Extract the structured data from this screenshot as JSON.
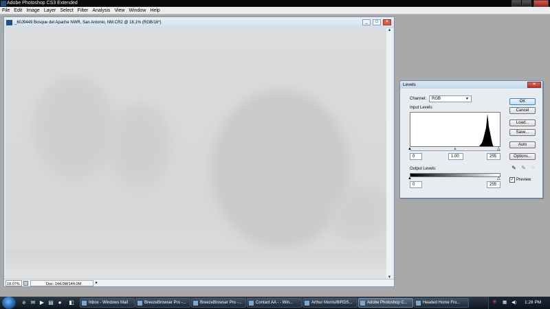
{
  "app": {
    "title": "Adobe Photoshop CS3 Extended"
  },
  "menu": [
    "File",
    "Edit",
    "Image",
    "Layer",
    "Select",
    "Filter",
    "Analysis",
    "View",
    "Window",
    "Help"
  ],
  "document": {
    "title": "_60J9449  Bosque del Apache NWR, San Antonio, NM.CR2 @ 18.1% (RGB/16*)",
    "zoom": "18.07%",
    "doc_info": "Doc: 144.0M/144.0M",
    "next_arrow": "▸",
    "btn_min": "_",
    "btn_max": "□",
    "btn_close": "✕",
    "scroll_up": "▲",
    "scroll_down": "▼"
  },
  "levels": {
    "title": "Levels",
    "close": "✕",
    "channel_label": "Channel:",
    "channel_value": "RGB",
    "caret": "▼",
    "input_label": "Input Levels:",
    "input_black": "0",
    "input_gamma": "1.00",
    "input_white": "255",
    "output_label": "Output Levels:",
    "output_black": "0",
    "output_white": "255",
    "buttons": {
      "ok": "OK",
      "cancel": "Cancel",
      "load": "Load...",
      "save": "Save...",
      "auto": "Auto",
      "options": "Options..."
    },
    "eyedropper_icon": "✎",
    "preview_label": "Preview",
    "preview_checked": true,
    "check_mark": "✓",
    "slider_black": "▲",
    "slider_gray": "▲",
    "slider_white": "△"
  },
  "taskbar": {
    "tasks": [
      "Inbox - Windows Mail",
      "BreezeBrowser Pro -...",
      "BreezeBrowser Pro -...",
      "Contact AA - - Win...",
      "Arthur Morris/BIRDS...",
      "Adobe Photoshop C...",
      "Headed Home Fro..."
    ],
    "active_index": 5,
    "clock": "1:28 PM",
    "quicklaunch_icons": [
      "ie-icon",
      "mail-icon",
      "media-icon",
      "folder-icon",
      "firefox-icon"
    ]
  }
}
